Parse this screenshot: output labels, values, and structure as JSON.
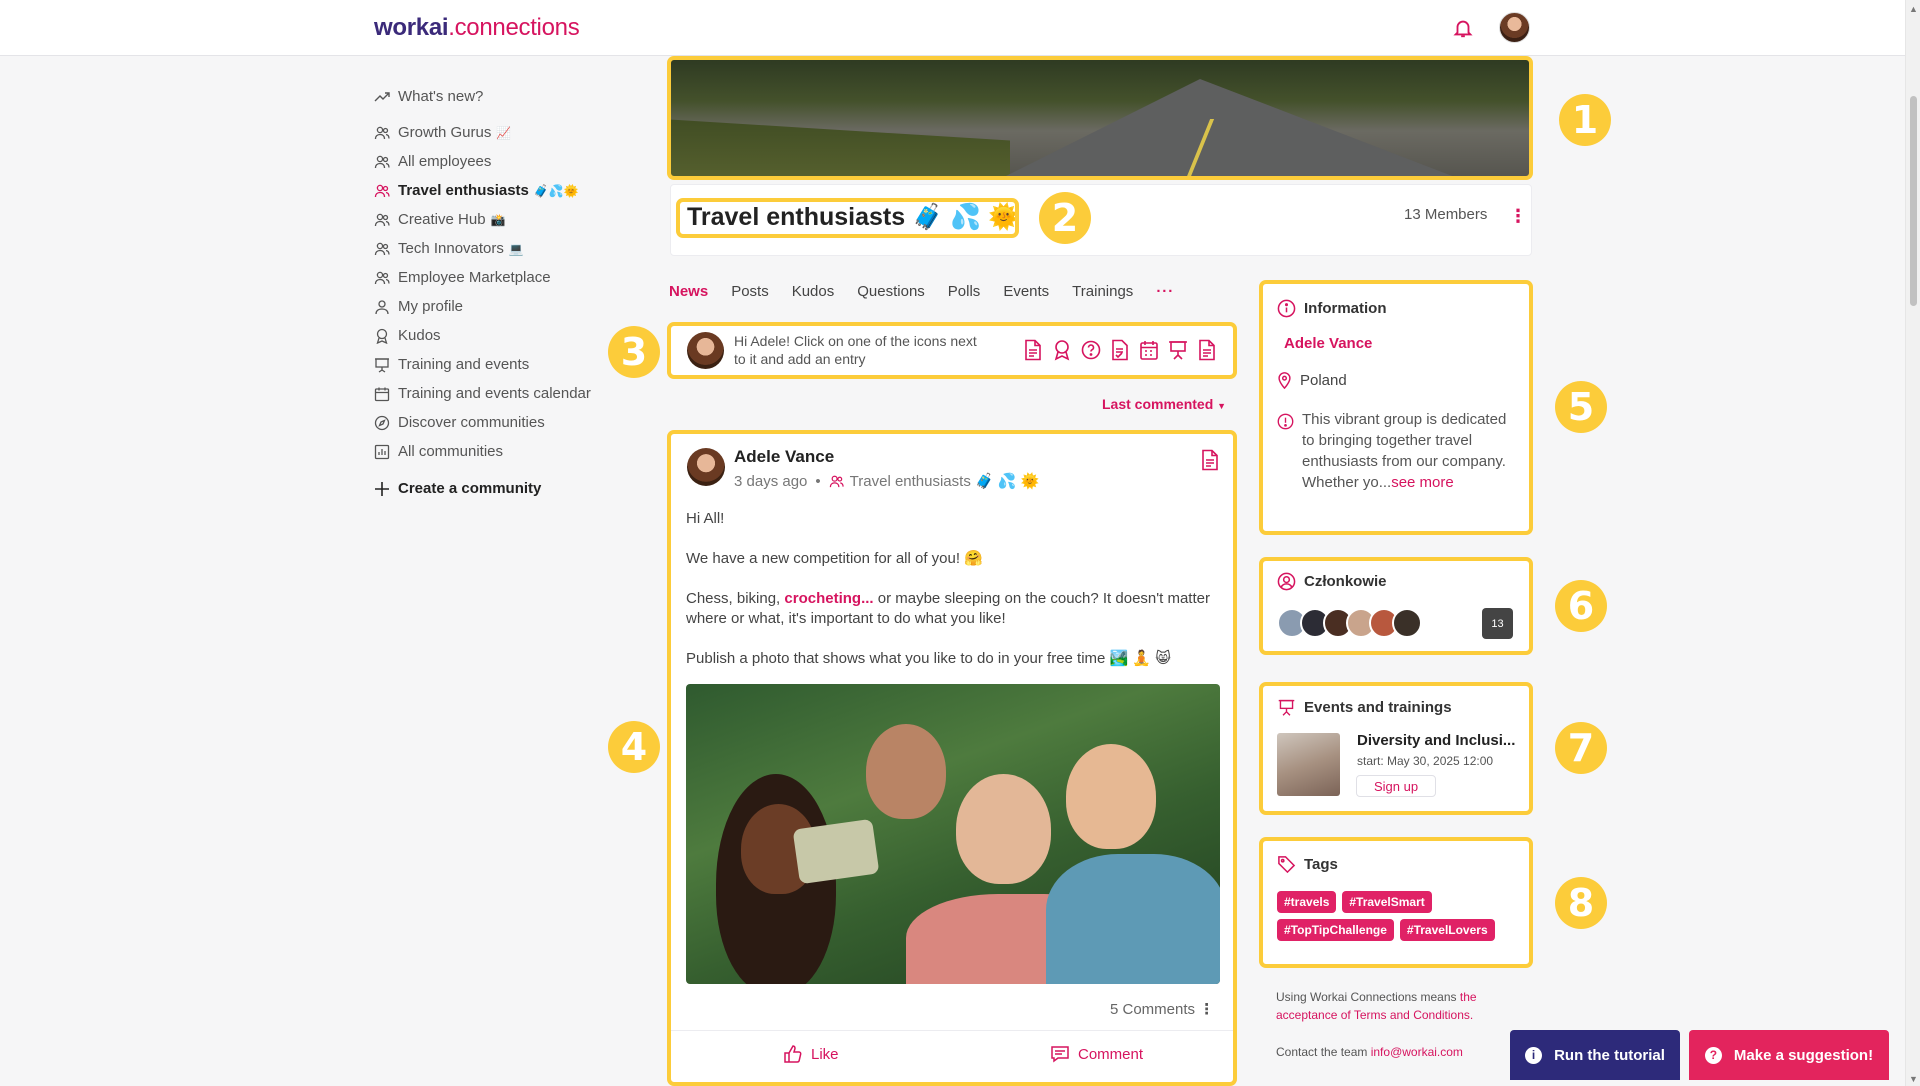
{
  "app": {
    "logo_part1": "workai",
    "logo_part2": ".connections"
  },
  "sidebar": {
    "items": [
      {
        "label": "What's new?",
        "icon": "trending-icon"
      },
      {
        "label": "Growth Gurus",
        "emoji": "📈",
        "icon": "group-icon"
      },
      {
        "label": "All employees",
        "icon": "group-icon"
      },
      {
        "label": "Travel enthusiasts",
        "emoji": "🧳💦🌞",
        "icon": "group-icon",
        "active": true
      },
      {
        "label": "Creative Hub",
        "emoji": "📸",
        "icon": "group-icon"
      },
      {
        "label": "Tech Innovators",
        "emoji": "💻",
        "icon": "group-icon"
      },
      {
        "label": "Employee Marketplace",
        "icon": "group-icon"
      },
      {
        "label": "My profile",
        "icon": "user-icon"
      },
      {
        "label": "Kudos",
        "icon": "award-icon"
      },
      {
        "label": "Training and events",
        "icon": "presentation-icon"
      },
      {
        "label": "Training and events calendar",
        "icon": "calendar-icon"
      },
      {
        "label": "Discover communities",
        "icon": "compass-icon"
      },
      {
        "label": "All communities",
        "icon": "chart-icon"
      }
    ],
    "create_label": "Create a community"
  },
  "group": {
    "title": "Travel enthusiasts 🧳 💦 🌞",
    "members": "13 Members"
  },
  "tabs": [
    "News",
    "Posts",
    "Kudos",
    "Questions",
    "Polls",
    "Events",
    "Trainings"
  ],
  "tabs_more": "···",
  "composer": {
    "prompt": "Hi Adele! Click on one of the icons next to it and add an entry"
  },
  "sort_label": "Last commented",
  "post": {
    "author": "Adele Vance",
    "time": "3 days ago",
    "group": "Travel enthusiasts 🧳 💦 🌞",
    "p1": "Hi All!",
    "p2": "We have a new competition for all of you! 🤗",
    "p3a": "Chess, biking, ",
    "p3link": "crocheting...",
    "p3b": " or maybe sleeping on the couch? It doesn't matter where or what, it's important to do what you like!",
    "p4": "Publish a photo that shows what you like to do in your free time 🏞️ 🧘 😸",
    "comments": "5 Comments",
    "like": "Like",
    "comment": "Comment"
  },
  "info": {
    "title": "Information",
    "name": "Adele Vance",
    "location": "Poland",
    "description": "This vibrant group is dedicated to bringing together travel enthusiasts from our company. Whether yo...",
    "see_more": "see more"
  },
  "members_card": {
    "title": "Członkowie",
    "count": "13"
  },
  "events": {
    "title": "Events and trainings",
    "name": "Diversity and Inclusi...",
    "start": "start: May 30, 2025 12:00",
    "signup": "Sign up"
  },
  "tags": {
    "title": "Tags",
    "items": [
      "#travels",
      "#TravelSmart",
      "#TopTipChallenge",
      "#TravelLovers"
    ]
  },
  "footer": {
    "terms_prefix": "Using Workai Connections means ",
    "terms_link": "the acceptance of Terms and Conditions.",
    "contact_prefix": "Contact the team ",
    "contact_email": "info@workai.com"
  },
  "buttons": {
    "tutorial": "Run the tutorial",
    "suggest": "Make a suggestion!"
  },
  "annotations": [
    "1",
    "2",
    "3",
    "4",
    "5",
    "6",
    "7",
    "8"
  ],
  "colors": {
    "accent": "#d6145f",
    "brand_dark": "#3b2a7a",
    "highlight": "#fccc3a",
    "tutorial_bg": "#2d2a7a",
    "suggest_bg": "#e3245d"
  }
}
